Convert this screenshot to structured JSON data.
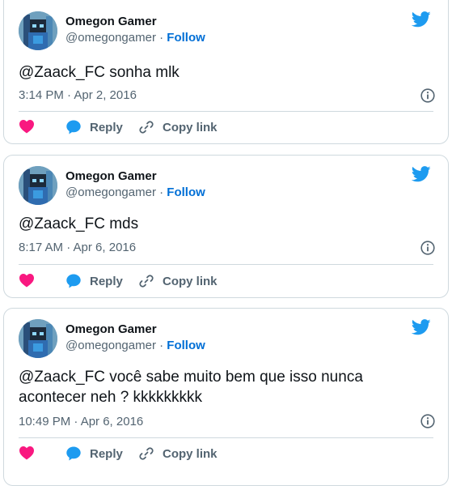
{
  "colors": {
    "accent": "#1d9bf0",
    "follow": "#006fd6",
    "like": "#f91880",
    "muted": "#536471"
  },
  "tweets": [
    {
      "name": "Omegon Gamer",
      "handle": "@omegongamer",
      "separator": "·",
      "follow": "Follow",
      "text": "@Zaack_FC sonha mlk",
      "timestamp": "3:14 PM · Apr 2, 2016",
      "reply": "Reply",
      "copy_link": "Copy link"
    },
    {
      "name": "Omegon Gamer",
      "handle": "@omegongamer",
      "separator": "·",
      "follow": "Follow",
      "text": "@Zaack_FC mds",
      "timestamp": "8:17 AM · Apr 6, 2016",
      "reply": "Reply",
      "copy_link": "Copy link"
    },
    {
      "name": "Omegon Gamer",
      "handle": "@omegongamer",
      "separator": "·",
      "follow": "Follow",
      "text": "@Zaack_FC você sabe muito bem que isso nunca acontecer neh ? kkkkkkkkk",
      "timestamp": "10:49 PM · Apr 6, 2016",
      "reply": "Reply",
      "copy_link": "Copy link"
    }
  ]
}
